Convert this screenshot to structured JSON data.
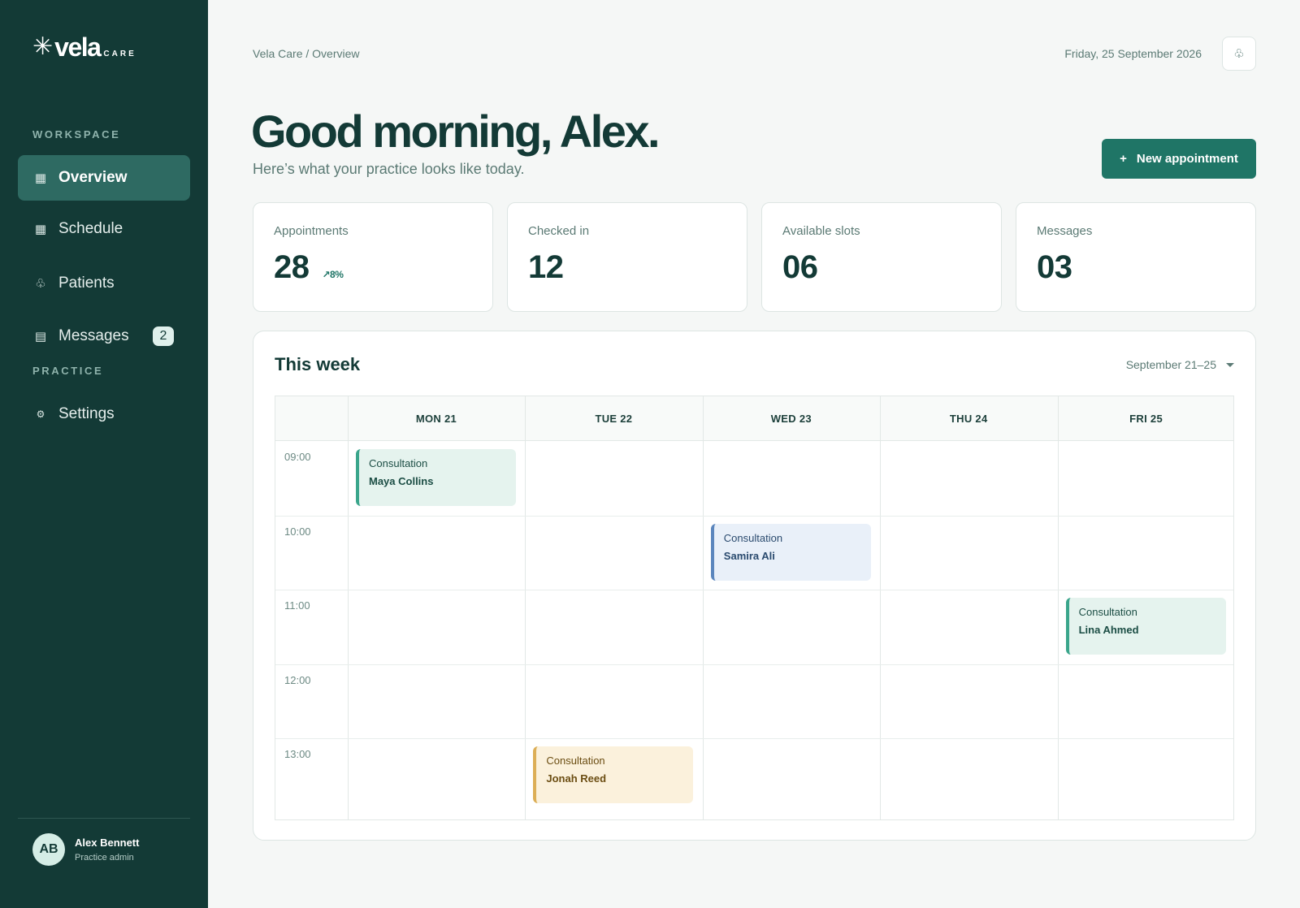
{
  "brand": {
    "mark": "✳",
    "name": "vela",
    "sub": "CARE"
  },
  "sidebar": {
    "workspace_label": "WORKSPACE",
    "practice_label": "PRACTICE",
    "items": [
      {
        "label": "Overview",
        "icon": "grid-icon",
        "glyph": "▦"
      },
      {
        "label": "Schedule",
        "icon": "calendar-icon",
        "glyph": "▦"
      },
      {
        "label": "Patients",
        "icon": "patients-icon",
        "glyph": "♧"
      },
      {
        "label": "Messages",
        "icon": "messages-icon",
        "glyph": "▤",
        "badge": "2"
      },
      {
        "label": "Settings",
        "icon": "gear-icon",
        "glyph": "⚙"
      }
    ],
    "user": {
      "initials": "AB",
      "name": "Alex Bennett",
      "role": "Practice admin"
    }
  },
  "header": {
    "breadcrumb": "Vela Care / Overview",
    "date": "Friday, 25 September 2026",
    "notify_glyph": "♧"
  },
  "hero": {
    "greeting": "Good morning, Alex.",
    "subtitle": "Here’s what your practice looks like today.",
    "new_button": "New appointment",
    "new_button_glyph": "+"
  },
  "stats": [
    {
      "label": "Appointments",
      "value": "28",
      "trend": "↗8%"
    },
    {
      "label": "Checked in",
      "value": "12"
    },
    {
      "label": "Available slots",
      "value": "06"
    },
    {
      "label": "Messages",
      "value": "03"
    }
  ],
  "week": {
    "title": "This week",
    "range": "September 21–25",
    "days": [
      "MON 21",
      "TUE 22",
      "WED 23",
      "THU 24",
      "FRI 25"
    ],
    "times": [
      "09:00",
      "10:00",
      "11:00",
      "12:00",
      "13:00"
    ],
    "events": [
      {
        "type": "Consultation",
        "patient": "Maya Collins",
        "day": 0,
        "slot": 0,
        "color": "green"
      },
      {
        "type": "Consultation",
        "patient": "Samira Ali",
        "day": 2,
        "slot": 1,
        "color": "blue"
      },
      {
        "type": "Consultation",
        "patient": "Lina Ahmed",
        "day": 4,
        "slot": 2,
        "color": "green"
      },
      {
        "type": "Consultation",
        "patient": "Jonah Reed",
        "day": 1,
        "slot": 4,
        "color": "amber"
      }
    ]
  },
  "colors": {
    "sidebar_bg": "#133a36",
    "accent": "#1f7566",
    "event_green": "#3aa58b",
    "event_blue": "#5b86bd",
    "event_amber": "#dcae56"
  }
}
